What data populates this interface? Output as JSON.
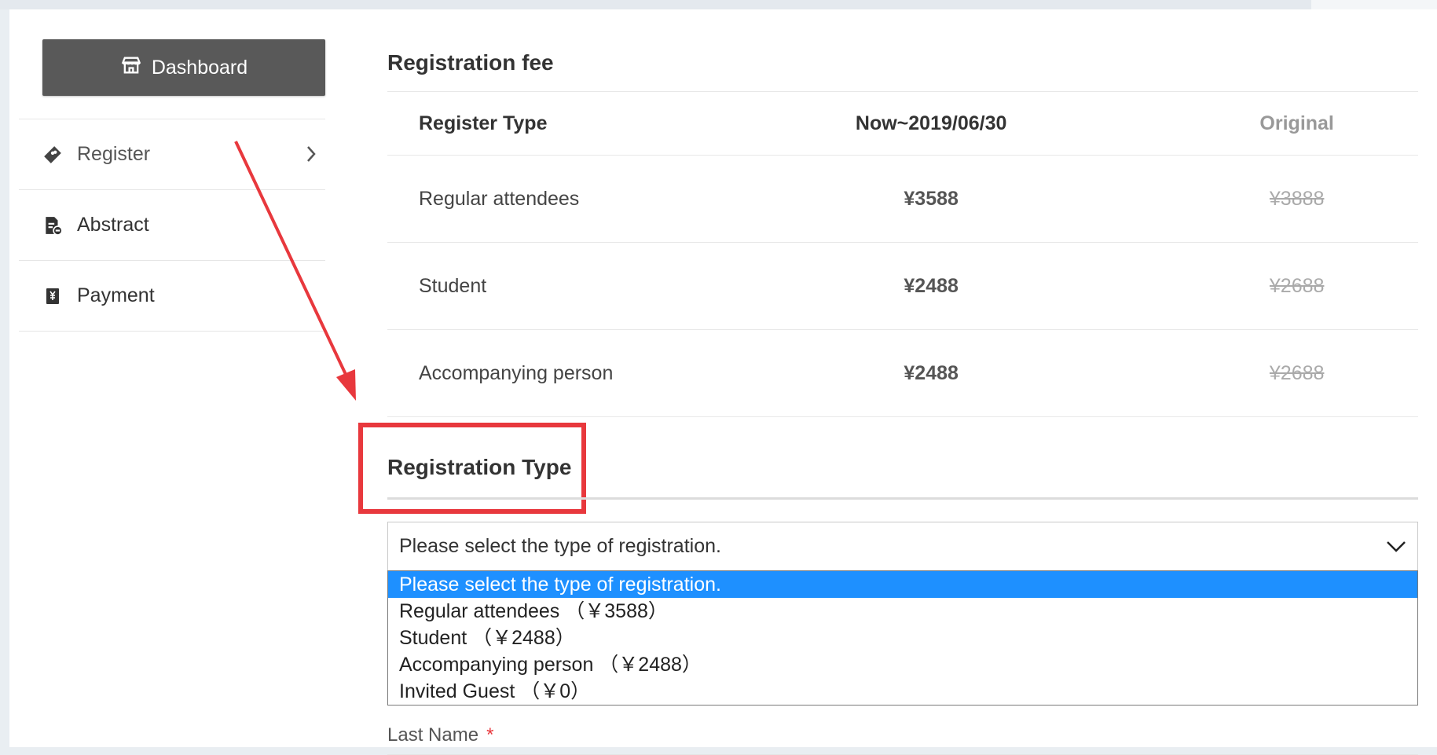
{
  "sidebar": {
    "dashboard_label": "Dashboard",
    "items": [
      {
        "label": "Register",
        "icon": "ticket-icon"
      },
      {
        "label": "Abstract",
        "icon": "document-icon"
      },
      {
        "label": "Payment",
        "icon": "yen-receipt-icon"
      }
    ]
  },
  "fee": {
    "title": "Registration fee",
    "headers": [
      "Register Type",
      "Now~2019/06/30",
      "Original"
    ],
    "rows": [
      {
        "type": "Regular attendees",
        "now": "¥3588",
        "original": "¥3888"
      },
      {
        "type": "Student",
        "now": "¥2488",
        "original": "¥2688"
      },
      {
        "type": "Accompanying person",
        "now": "¥2488",
        "original": "¥2688"
      }
    ]
  },
  "registration_type": {
    "title": "Registration Type",
    "selected": "Please select the type of registration.",
    "options": [
      "Please select the type of registration.",
      "Regular attendees （￥3588）",
      "Student （￥2488）",
      "Accompanying person （￥2488）",
      "Invited Guest （￥0）"
    ]
  },
  "form": {
    "last_name_label": "Last Name",
    "required_mark": "*"
  },
  "colors": {
    "accent_red": "#e8383d",
    "selected_option": "#1e90ff",
    "dashboard_bg": "#595959"
  }
}
